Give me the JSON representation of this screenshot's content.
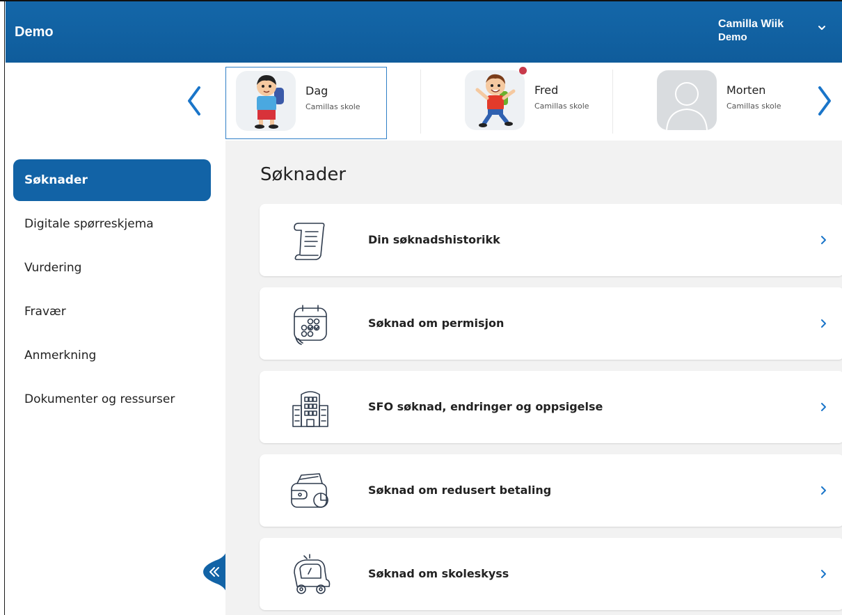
{
  "header": {
    "title": "Demo",
    "user_name": "Camilla Wiik",
    "user_org": "Demo"
  },
  "children": [
    {
      "name": "Dag",
      "school": "Camillas skole",
      "selected": true,
      "notification": false
    },
    {
      "name": "Fred",
      "school": "Camillas skole",
      "selected": false,
      "notification": true
    },
    {
      "name": "Morten",
      "school": "Camillas skole",
      "selected": false,
      "notification": false
    }
  ],
  "sidebar": {
    "items": [
      {
        "label": "Søknader",
        "active": true
      },
      {
        "label": "Digitale spørreskjema",
        "active": false
      },
      {
        "label": "Vurdering",
        "active": false
      },
      {
        "label": "Fravær",
        "active": false
      },
      {
        "label": "Anmerkning",
        "active": false
      },
      {
        "label": "Dokumenter og ressurser",
        "active": false
      }
    ]
  },
  "main": {
    "title": "Søknader",
    "cards": [
      {
        "label": "Din søknadshistorikk",
        "icon": "scroll-icon"
      },
      {
        "label": "Søknad om permisjon",
        "icon": "calendar-icon"
      },
      {
        "label": "SFO søknad, endringer og oppsigelse",
        "icon": "school-building-icon"
      },
      {
        "label": "Søknad om redusert betaling",
        "icon": "wallet-icon"
      },
      {
        "label": "Søknad om skoleskyss",
        "icon": "school-bus-icon"
      }
    ]
  },
  "colors": {
    "header": "#1467a9",
    "accent": "#1263a6",
    "main_bg": "#f2f2f2",
    "notification_dot": "#c83a4b"
  }
}
